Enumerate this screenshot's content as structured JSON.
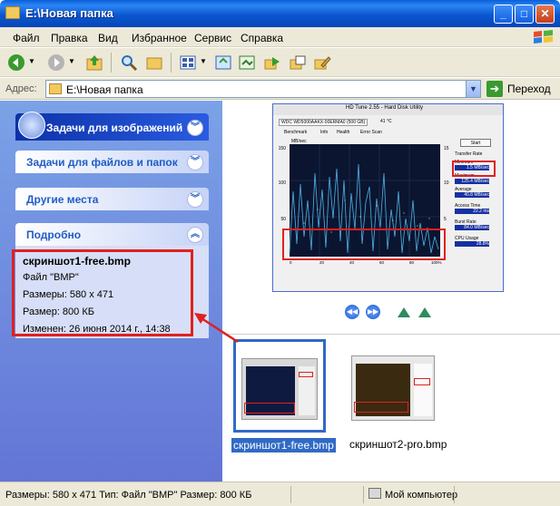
{
  "window": {
    "title": "E:\\Новая папка"
  },
  "menu": [
    "Файл",
    "Правка",
    "Вид",
    "Избранное",
    "Сервис",
    "Справка"
  ],
  "address": {
    "label": "Адрес:",
    "value": "E:\\Новая папка",
    "go_label": "Переход"
  },
  "taskpane": {
    "image_tasks": "Задачи для изображений",
    "file_tasks": "Задачи для файлов и папок",
    "other_places": "Другие места",
    "details_header": "Подробно",
    "details": {
      "name": "скриншот1-free.bmp",
      "type": "Файл \"BMP\"",
      "dimensions": "Размеры: 580 x 471",
      "size": "Размер: 800 КБ",
      "modified": "Изменен: 26 июня 2014 г., 14:38"
    }
  },
  "preview": {
    "title": "HD Tune 2.55 - Hard Disk Utility",
    "drive": "WDC WD5000AAKX-00ERMA0 (500 GB)",
    "temperature": "41 °C",
    "tabs": [
      "Benchmark",
      "Info",
      "Health",
      "Error Scan"
    ],
    "start_button": "Start",
    "y_unit": "MB/sec",
    "y_ticks": [
      "150",
      "100",
      "50"
    ],
    "ms_ticks": [
      "15",
      "10",
      "5"
    ],
    "x_ticks": [
      "0",
      "10",
      "20",
      "30",
      "40",
      "50",
      "60",
      "70",
      "80",
      "90",
      "100%"
    ],
    "transfer_rate_label": "Transfer Rate",
    "minimum_label": "Minimum",
    "minimum_value": "1.5 MB/sec",
    "maximum_label": "Maximum",
    "maximum_value": "125.4 MB/sec",
    "average_label": "Average",
    "average_value": "40.8 MB/sec",
    "access_label": "Access Time",
    "access_value": "22.2 ms",
    "burst_label": "Burst Rate",
    "burst_value": "84.0 MB/sec",
    "cpu_label": "CPU Usage",
    "cpu_value": "28.8%"
  },
  "thumbnails": [
    {
      "label": "скриншот1-free.bmp",
      "selected": true
    },
    {
      "label": "скриншот2-pro.bmp",
      "selected": false
    }
  ],
  "status": {
    "text": "Размеры: 580 x 471 Тип: Файл \"BMP\" Размер: 800 КБ",
    "computer": "Мой компьютер"
  },
  "colors": {
    "title_bar": "#0b57d0",
    "task_pane": "#6f8edf",
    "highlight": "#e02020",
    "selection": "#316ac5"
  }
}
